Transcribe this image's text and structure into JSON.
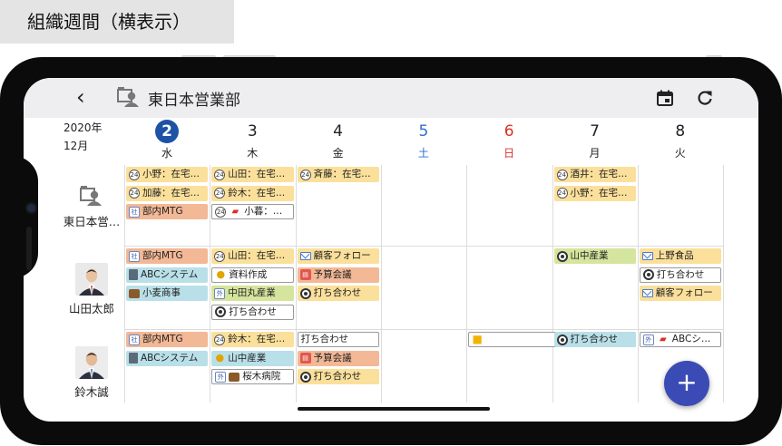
{
  "caption": "組織週間（横表示）",
  "appbar": {
    "back_icon": "chevron-left-icon",
    "group_icon": "group-icon",
    "title": "東日本営業部",
    "calendar_icon": "calendar-icon",
    "refresh_icon": "refresh-icon"
  },
  "header": {
    "year": "2020年",
    "month": "12月",
    "days": [
      {
        "num": "2",
        "weekday": "水",
        "color": "#222222",
        "today": true
      },
      {
        "num": "3",
        "weekday": "木",
        "color": "#222222"
      },
      {
        "num": "4",
        "weekday": "金",
        "color": "#222222"
      },
      {
        "num": "5",
        "weekday": "土",
        "color": "#2f6fd1"
      },
      {
        "num": "6",
        "weekday": "日",
        "color": "#d93025"
      },
      {
        "num": "7",
        "weekday": "月",
        "color": "#222222"
      },
      {
        "num": "8",
        "weekday": "火",
        "color": "#222222"
      }
    ]
  },
  "rows": [
    {
      "name": "東日本営…",
      "icon": "group-icon"
    },
    {
      "name": "山田太郎",
      "icon": "avatar"
    },
    {
      "name": "鈴木誠",
      "icon": "avatar"
    }
  ],
  "colors": {
    "yellow": "#fbe09b",
    "orange": "#f3b896",
    "blue": "#b9e0e8",
    "green": "#d5e59d",
    "white": "#ffffff",
    "today": "#1e52a6",
    "fab": "#3b4bb5"
  },
  "events": [
    {
      "row": 0,
      "day": 0,
      "slot": 0,
      "text": "小野：在宅…",
      "icon": "clock-icon",
      "color": "yellow"
    },
    {
      "row": 0,
      "day": 0,
      "slot": 1,
      "text": "加藤：在宅…",
      "icon": "clock-icon",
      "color": "yellow"
    },
    {
      "row": 0,
      "day": 0,
      "slot": 2,
      "text": "部内MTG",
      "icon": "meeting-icon",
      "color": "orange"
    },
    {
      "row": 0,
      "day": 1,
      "slot": 0,
      "text": "山田：在宅…",
      "icon": "clock-icon",
      "color": "yellow"
    },
    {
      "row": 0,
      "day": 1,
      "slot": 1,
      "text": "鈴木：在宅…",
      "icon": "clock-icon",
      "color": "yellow"
    },
    {
      "row": 0,
      "day": 1,
      "slot": 2,
      "text": "小暮：…",
      "icon": "clock-icon",
      "icon2": "car-icon",
      "color": "white"
    },
    {
      "row": 0,
      "day": 2,
      "slot": 0,
      "text": "斉藤：在宅…",
      "icon": "clock-icon",
      "color": "yellow"
    },
    {
      "row": 0,
      "day": 5,
      "slot": 0,
      "text": "酒井：在宅…",
      "icon": "clock-icon",
      "color": "yellow"
    },
    {
      "row": 0,
      "day": 5,
      "slot": 1,
      "text": "小野：在宅…",
      "icon": "clock-icon",
      "color": "yellow"
    },
    {
      "row": 1,
      "day": 0,
      "slot": 0,
      "text": "部内MTG",
      "icon": "meeting-icon",
      "color": "orange"
    },
    {
      "row": 1,
      "day": 0,
      "slot": 1,
      "text": "ABCシステム",
      "icon": "document-icon",
      "color": "blue"
    },
    {
      "row": 1,
      "day": 0,
      "slot": 2,
      "text": "小麦商事",
      "icon": "briefcase-icon",
      "color": "blue"
    },
    {
      "row": 1,
      "day": 1,
      "slot": 0,
      "text": "山田：在宅…",
      "icon": "clock-icon",
      "color": "yellow"
    },
    {
      "row": 1,
      "day": 1,
      "slot": 1,
      "text": "資料作成",
      "icon": "lightbulb-icon",
      "color": "white"
    },
    {
      "row": 1,
      "day": 1,
      "slot": 2,
      "text": "中田丸産業",
      "icon": "external-icon",
      "color": "green"
    },
    {
      "row": 1,
      "day": 1,
      "slot": 3,
      "text": "打ち合わせ",
      "icon": "target-icon",
      "color": "white"
    },
    {
      "row": 1,
      "day": 2,
      "slot": 0,
      "text": "顧客フォロー",
      "icon": "mail-icon",
      "color": "yellow"
    },
    {
      "row": 1,
      "day": 2,
      "slot": 1,
      "text": "予算会議",
      "icon": "calendar-small-icon",
      "color": "orange"
    },
    {
      "row": 1,
      "day": 2,
      "slot": 2,
      "text": "打ち合わせ",
      "icon": "target-icon",
      "color": "yellow"
    },
    {
      "row": 1,
      "day": 5,
      "slot": 0,
      "text": "山中産業",
      "icon": "target-icon",
      "color": "green"
    },
    {
      "row": 1,
      "day": 6,
      "slot": 0,
      "text": "上野食品",
      "icon": "mail-icon",
      "color": "yellow"
    },
    {
      "row": 1,
      "day": 6,
      "slot": 1,
      "text": "打ち合わせ",
      "icon": "target-icon",
      "color": "white"
    },
    {
      "row": 1,
      "day": 6,
      "slot": 2,
      "text": "顧客フォロー",
      "icon": "mail-icon",
      "color": "yellow"
    },
    {
      "row": 2,
      "day": 0,
      "slot": 0,
      "text": "部内MTG",
      "icon": "meeting-icon",
      "color": "orange"
    },
    {
      "row": 2,
      "day": 0,
      "slot": 1,
      "text": "ABCシステム",
      "icon": "document-icon",
      "color": "blue"
    },
    {
      "row": 2,
      "day": 1,
      "slot": 0,
      "text": "鈴木：在宅…",
      "icon": "clock-icon",
      "color": "yellow"
    },
    {
      "row": 2,
      "day": 1,
      "slot": 1,
      "text": "山中産業",
      "icon": "lightbulb-icon",
      "color": "blue"
    },
    {
      "row": 2,
      "day": 1,
      "slot": 2,
      "text": "桜木病院",
      "icon": "external-icon",
      "icon2": "briefcase-icon",
      "color": "white"
    },
    {
      "row": 2,
      "day": 2,
      "slot": 0,
      "text": "打ち合わせ",
      "icon": "",
      "color": "white"
    },
    {
      "row": 2,
      "day": 2,
      "slot": 1,
      "text": "予算会議",
      "icon": "calendar-small-icon",
      "color": "orange"
    },
    {
      "row": 2,
      "day": 2,
      "slot": 2,
      "text": "打ち合わせ",
      "icon": "target-icon",
      "color": "yellow"
    },
    {
      "row": 2,
      "day": 4,
      "slot": 0,
      "text": "",
      "icon": "lock-icon",
      "color": "white",
      "span": 2
    },
    {
      "row": 2,
      "day": 5,
      "slot": 0,
      "text": "打ち合わせ",
      "icon": "target-icon",
      "color": "blue"
    },
    {
      "row": 2,
      "day": 6,
      "slot": 0,
      "text": "ABCシ…",
      "icon": "external-icon",
      "icon2": "car-icon",
      "color": "white"
    }
  ],
  "fab": {
    "label": "+",
    "icon": "plus-icon"
  }
}
